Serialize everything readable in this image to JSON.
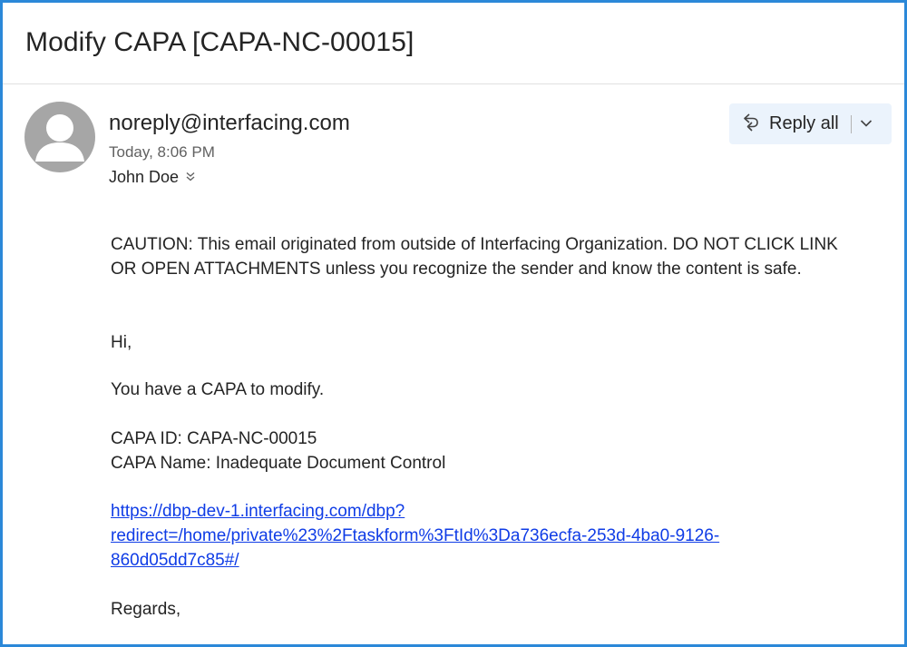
{
  "email": {
    "subject": "Modify CAPA [CAPA-NC-00015]",
    "sender": "noreply@interfacing.com",
    "time": "Today, 8:06 PM",
    "recipient": "John Doe"
  },
  "actions": {
    "reply_all_label": "Reply all"
  },
  "body": {
    "caution_line1": "CAUTION: This email originated from outside of Interfacing Organization. DO NOT CLICK LINK",
    "caution_line2": "OR OPEN ATTACHMENTS unless you recognize the sender and know the content is safe.",
    "greeting": "Hi,",
    "intro": "You have a CAPA to modify.",
    "capa_id": "CAPA ID: CAPA-NC-00015",
    "capa_name": "CAPA Name: Inadequate Document Control",
    "link_line1": "https://dbp-dev-1.interfacing.com/dbp?",
    "link_line2": "redirect=/home/private%23%2Ftaskform%3FtId%3Da736ecfa-253d-4ba0-9126-",
    "link_line3": "860d05dd7c85#/",
    "closing": "Regards,"
  },
  "icons": {
    "avatar": "person-avatar-icon",
    "reply_all": "reply-all-icon",
    "dropdown": "chevron-down-icon",
    "expand_recipients": "double-chevron-down-icon"
  },
  "colors": {
    "frame_border": "#2b88d8",
    "reply_button_bg": "#ebf3fc",
    "link": "#0f3ce6",
    "avatar_bg": "#a6a6a6"
  }
}
